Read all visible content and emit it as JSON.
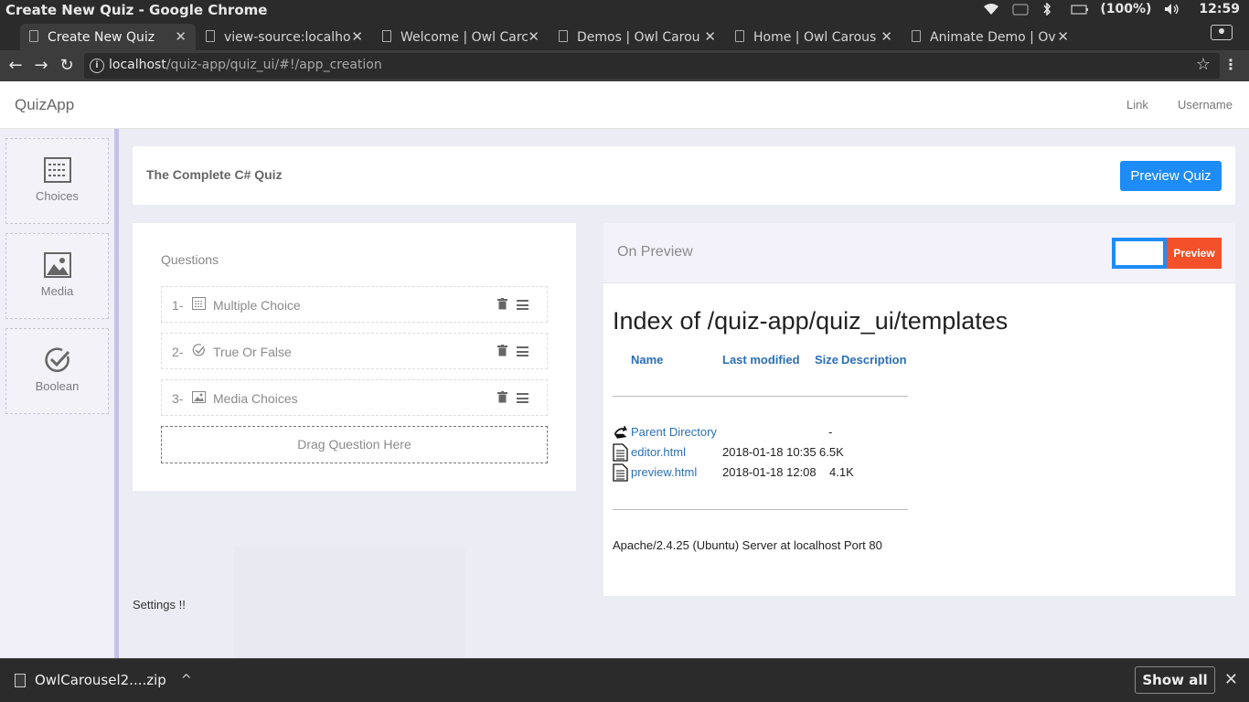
{
  "os": {
    "window_title": "Create New Quiz - Google Chrome",
    "battery": "(100%)",
    "clock": "12:59"
  },
  "tabs": [
    {
      "label": "Create New Quiz"
    },
    {
      "label": "view-source:localho"
    },
    {
      "label": "Welcome | Owl Carc"
    },
    {
      "label": "Demos | Owl Carou"
    },
    {
      "label": "Home | Owl Carous"
    },
    {
      "label": "Animate Demo | Ov"
    }
  ],
  "address": {
    "host": "localhost",
    "path": "/quiz-app/quiz_ui/#!/app_creation"
  },
  "navbar": {
    "brand": "QuizApp",
    "link": "Link",
    "username": "Username"
  },
  "sidebar": {
    "items": [
      {
        "label": "Choices",
        "icon": "choices-icon"
      },
      {
        "label": "Media",
        "icon": "image-icon"
      },
      {
        "label": "Boolean",
        "icon": "check-circle-icon"
      }
    ]
  },
  "quiz": {
    "title": "The Complete C# Quiz",
    "preview_button": "Preview Quiz"
  },
  "questions": {
    "heading": "Questions",
    "items": [
      {
        "num": "1-",
        "label": "Multiple Choice",
        "icon": "choices-icon"
      },
      {
        "num": "2-",
        "label": "True Or False",
        "icon": "check-circle-icon"
      },
      {
        "num": "3-",
        "label": "Media Choices",
        "icon": "image-icon"
      }
    ],
    "drop_zone": "Drag Question Here"
  },
  "settings_label": "Settings !!",
  "preview": {
    "title": "On Preview",
    "toggle_label": "Preview",
    "index": {
      "title": "Index of /quiz-app/quiz_ui/templates",
      "headers": {
        "name": "Name",
        "modified": "Last modified",
        "size": "Size",
        "description": "Description"
      },
      "rows": [
        {
          "name": "Parent Directory",
          "date": "",
          "size": "-"
        },
        {
          "name": "editor.html",
          "date": "2018-01-18 10:35",
          "size": "6.5K"
        },
        {
          "name": "preview.html",
          "date": "2018-01-18 12:08",
          "size": "4.1K"
        }
      ],
      "footer": "Apache/2.4.25 (Ubuntu) Server at localhost Port 80"
    }
  },
  "downloads": {
    "file": "OwlCarousel2....zip",
    "show_all": "Show all"
  },
  "colors": {
    "accent_blue": "#1e8cf7",
    "toggle_red": "#f4502a",
    "link_blue": "#2a6fb8",
    "sidebar_border": "#c5c1ea"
  }
}
